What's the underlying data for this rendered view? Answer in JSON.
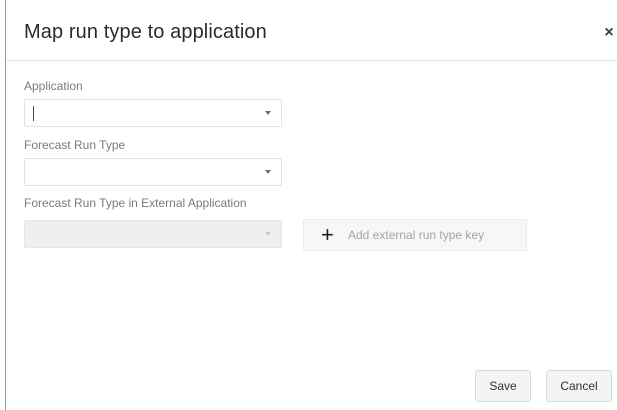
{
  "dialog": {
    "title": "Map run type to application",
    "close_symbol": "×"
  },
  "fields": {
    "application": {
      "label": "Application",
      "value": ""
    },
    "forecast_run_type": {
      "label": "Forecast Run Type",
      "value": ""
    },
    "external_run_type": {
      "label": "Forecast Run Type in External Application",
      "value": "",
      "disabled": true
    }
  },
  "add_external_key": {
    "icon": "plus-icon",
    "symbol": "+",
    "label": "Add external run type key"
  },
  "footer": {
    "save_label": "Save",
    "cancel_label": "Cancel"
  }
}
